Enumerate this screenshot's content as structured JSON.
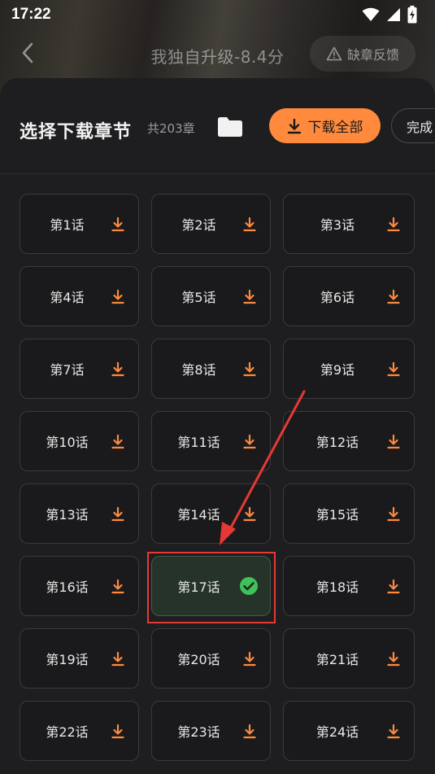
{
  "status": {
    "time": "17:22"
  },
  "header": {
    "book_title": "我独自升级-8.4分",
    "feedback_label": "缺章反馈"
  },
  "sheet": {
    "title": "选择下载章节",
    "count": "共203章",
    "download_all_label": "下载全部",
    "done_label": "完成"
  },
  "chapters": [
    {
      "label": "第1话",
      "state": "download"
    },
    {
      "label": "第2话",
      "state": "download"
    },
    {
      "label": "第3话",
      "state": "download"
    },
    {
      "label": "第4话",
      "state": "download"
    },
    {
      "label": "第5话",
      "state": "download"
    },
    {
      "label": "第6话",
      "state": "download"
    },
    {
      "label": "第7话",
      "state": "download"
    },
    {
      "label": "第8话",
      "state": "download"
    },
    {
      "label": "第9话",
      "state": "download"
    },
    {
      "label": "第10话",
      "state": "download"
    },
    {
      "label": "第11话",
      "state": "download"
    },
    {
      "label": "第12话",
      "state": "download"
    },
    {
      "label": "第13话",
      "state": "download"
    },
    {
      "label": "第14话",
      "state": "download"
    },
    {
      "label": "第15话",
      "state": "download"
    },
    {
      "label": "第16话",
      "state": "download"
    },
    {
      "label": "第17话",
      "state": "selected"
    },
    {
      "label": "第18话",
      "state": "download"
    },
    {
      "label": "第19话",
      "state": "download"
    },
    {
      "label": "第20话",
      "state": "download"
    },
    {
      "label": "第21话",
      "state": "download"
    },
    {
      "label": "第22话",
      "state": "download"
    },
    {
      "label": "第23话",
      "state": "download"
    },
    {
      "label": "第24话",
      "state": "download"
    }
  ],
  "colors": {
    "accent": "#ff8a3d",
    "check": "#3ec35a",
    "annotation": "#e53935"
  }
}
